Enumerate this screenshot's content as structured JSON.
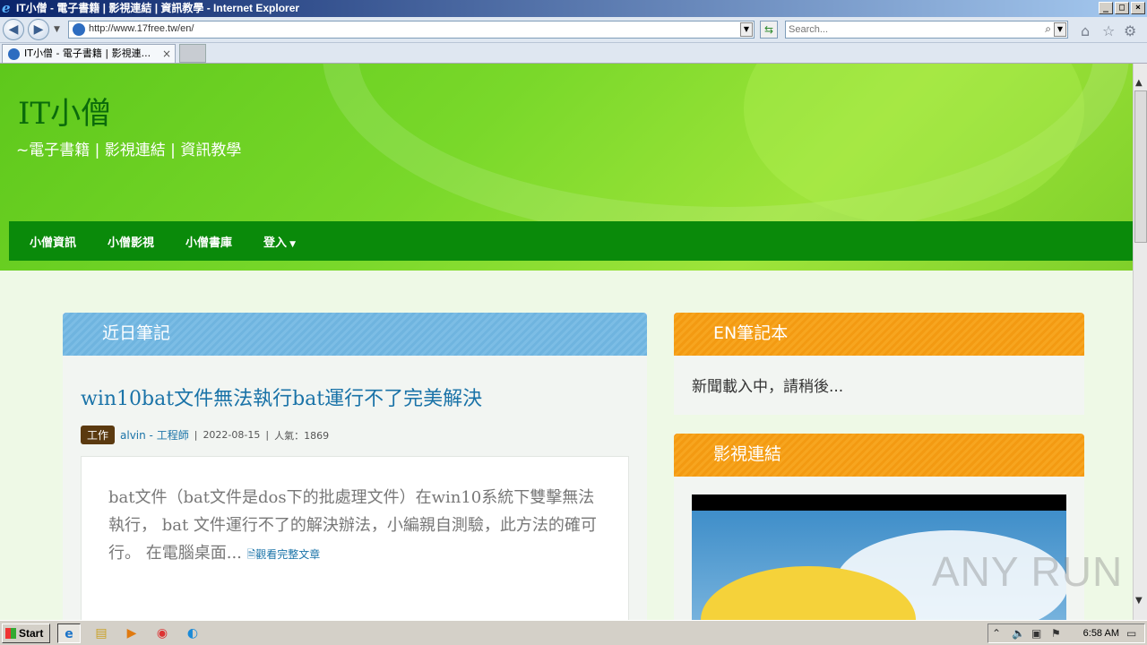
{
  "window": {
    "title": "IT小僧 - 電子書籍 | 影視連結 | 資訊教學 - Internet Explorer",
    "controls": [
      "_",
      "□",
      "×"
    ]
  },
  "browser": {
    "url": "http://www.17free.tw/en/",
    "search_placeholder": "Search...",
    "tab_title": "IT小僧 - 電子書籍 | 影視連...",
    "tab_close": "×"
  },
  "site": {
    "title": "IT小僧",
    "subtitle": "~電子書籍 | 影視連結 | 資訊教學",
    "menu": [
      "小僧資訊",
      "小僧影視",
      "小僧書庫",
      "登入"
    ]
  },
  "left_panel": {
    "heading": "近日筆記",
    "post": {
      "title": "win10bat文件無法執行bat運行不了完美解決",
      "tag": "工作",
      "author": "alvin - 工程師",
      "date": "2022-08-15",
      "popularity": "人氣：1869",
      "excerpt": "bat文件（bat文件是dos下的批處理文件）在win10系統下雙擊無法執行， bat 文件運行不了的解決辦法，小編親自測驗，此方法的確可行。 在電腦桌面...",
      "read_more": "觀看完整文章"
    }
  },
  "right_panels": {
    "notes_heading": "EN筆記本",
    "notes_loading": "新聞載入中，請稍後...",
    "video_heading": "影視連結"
  },
  "watermark": "ANY RUN",
  "taskbar": {
    "start_label": "Start",
    "clock": "6:58 AM"
  }
}
